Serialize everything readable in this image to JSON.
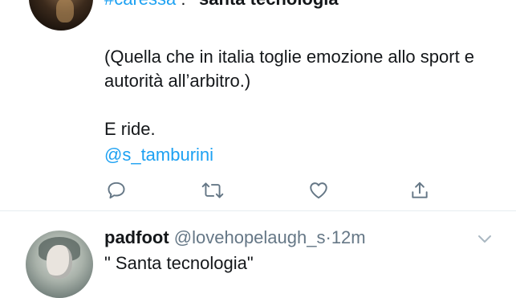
{
  "tweet1": {
    "header_hashtag": "#caressa",
    "header_separator": " : ",
    "header_quote": "\"santa tecnologia\"",
    "paragraph1": "(Quella che in italia toglie emozione allo sport e autorità all’arbitro.)",
    "paragraph2": "E ride.",
    "mention": "@s_tamburini",
    "actions": [
      {
        "icon": "reply-icon"
      },
      {
        "icon": "retweet-icon"
      },
      {
        "icon": "like-icon"
      },
      {
        "icon": "share-icon"
      }
    ]
  },
  "tweet2": {
    "name": "padfoot",
    "handle": "@lovehopelaugh_s",
    "dot": "·",
    "time": "12m",
    "text": "\" Santa tecnologia\"",
    "menu_icon": "chevron-down-icon"
  },
  "colors": {
    "link": "#1da1f2",
    "secondary_text": "#657786",
    "primary_text": "#14171a",
    "divider": "#e6ecf0"
  }
}
